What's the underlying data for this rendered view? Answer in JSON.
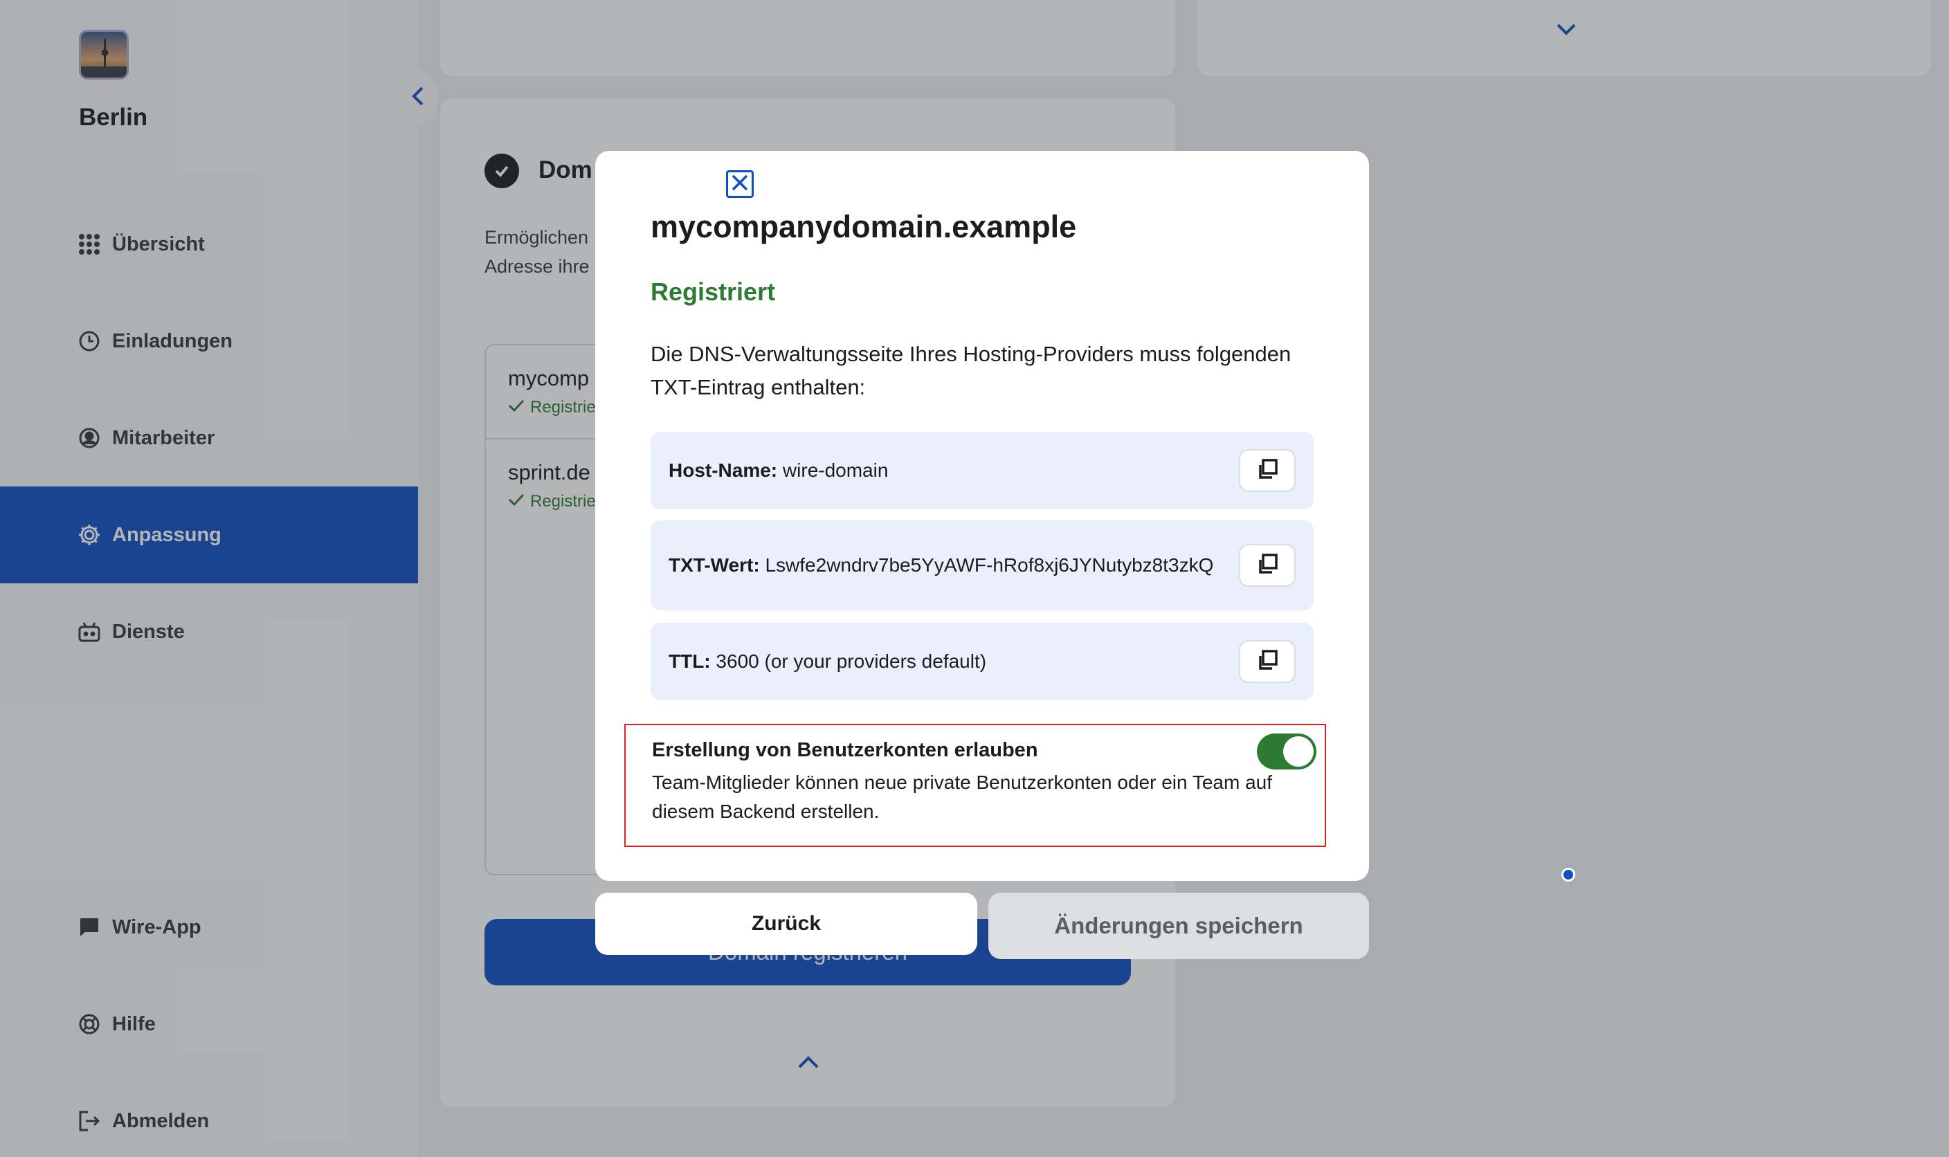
{
  "sidebar": {
    "team_name": "Berlin",
    "items": [
      {
        "label": "Übersicht",
        "icon": "grid-icon"
      },
      {
        "label": "Einladungen",
        "icon": "clock-icon"
      },
      {
        "label": "Mitarbeiter",
        "icon": "user-circle-icon"
      },
      {
        "label": "Anpassung",
        "icon": "gear-icon",
        "active": true
      },
      {
        "label": "Dienste",
        "icon": "robot-icon"
      },
      {
        "label": "Wire-App",
        "icon": "chat-bubble-icon"
      },
      {
        "label": "Hilfe",
        "icon": "lifebuoy-icon"
      },
      {
        "label": "Abmelden",
        "icon": "logout-icon"
      }
    ]
  },
  "background_card": {
    "title": "Dom",
    "description_line1": "Ermöglichen",
    "description_line2": "Adresse ihre",
    "domains": [
      {
        "name": "mycomp",
        "status": "Registrie"
      },
      {
        "name": "sprint.de",
        "status": "Registrie"
      }
    ],
    "register_button": "Domain registrieren"
  },
  "modal": {
    "title": "mycompanydomain.example",
    "status": "Registriert",
    "description": "Die DNS-Verwaltungsseite Ihres Hosting-Providers muss folgenden TXT-Eintrag enthalten:",
    "records": [
      {
        "label": "Host-Name:",
        "value": "wire-domain"
      },
      {
        "label": "TXT-Wert:",
        "value": "Lswfe2wndrv7be5YyAWF-hRof8xj6JYNutybz8t3zkQ"
      },
      {
        "label": "TTL:",
        "value": "3600 (or your providers default)"
      }
    ],
    "toggle": {
      "title": "Erstellung von Benutzerkonten erlauben",
      "description": "Team-Mitglieder können neue private Benutzerkonten oder ein Team auf diesem Backend erstellen.",
      "enabled": true
    },
    "back_button": "Zurück",
    "save_button": "Änderungen speichern"
  },
  "colors": {
    "accent": "#0f4fc3",
    "success": "#2d7a35",
    "highlight_border": "#e02020"
  }
}
